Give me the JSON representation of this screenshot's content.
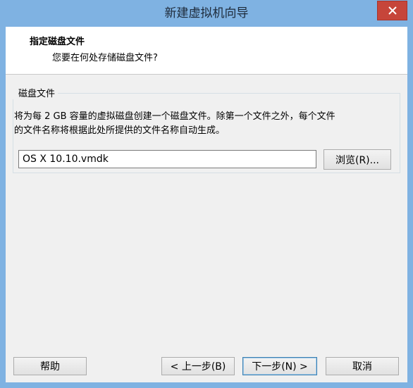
{
  "window": {
    "title": "新建虚拟机向导"
  },
  "header": {
    "title": "指定磁盘文件",
    "subtitle": "您要在何处存储磁盘文件?"
  },
  "disk_file": {
    "group_label": "磁盘文件",
    "description": "将为每 2 GB 容量的虚拟磁盘创建一个磁盘文件。除第一个文件之外，每个文件\n的文件名称将根据此处所提供的文件名称自动生成。",
    "filename": "OS X 10.10.vmdk",
    "browse_label": "浏览(R)..."
  },
  "footer": {
    "help_label": "帮助",
    "back_label": "< 上一步(B)",
    "next_label": "下一步(N) >",
    "cancel_label": "取消"
  },
  "icons": {
    "close": "close-icon"
  },
  "colors": {
    "frame": "#7fb2e2",
    "close_button": "#c6453a"
  }
}
